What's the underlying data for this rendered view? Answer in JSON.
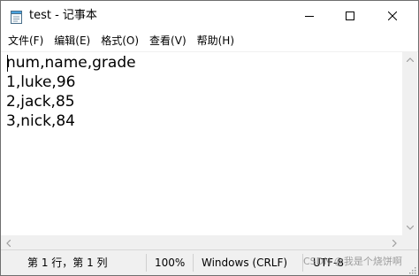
{
  "window": {
    "title": "test - 记事本"
  },
  "menu": [
    {
      "label": "文件(F)"
    },
    {
      "label": "编辑(E)"
    },
    {
      "label": "格式(O)"
    },
    {
      "label": "查看(V)"
    },
    {
      "label": "帮助(H)"
    }
  ],
  "editor": {
    "content": "num,name,grade\n1,luke,96\n2,jack,85\n3,nick,84"
  },
  "status": {
    "position": "第 1 行，第 1 列",
    "zoom": "100%",
    "line_ending": "Windows (CRLF)",
    "encoding": "UTF-8"
  },
  "watermark": "CSDN @我是个烧饼啊",
  "icons": {
    "app": "notepad-icon",
    "minimize": "minimize-icon",
    "maximize": "maximize-icon",
    "close": "close-icon"
  }
}
